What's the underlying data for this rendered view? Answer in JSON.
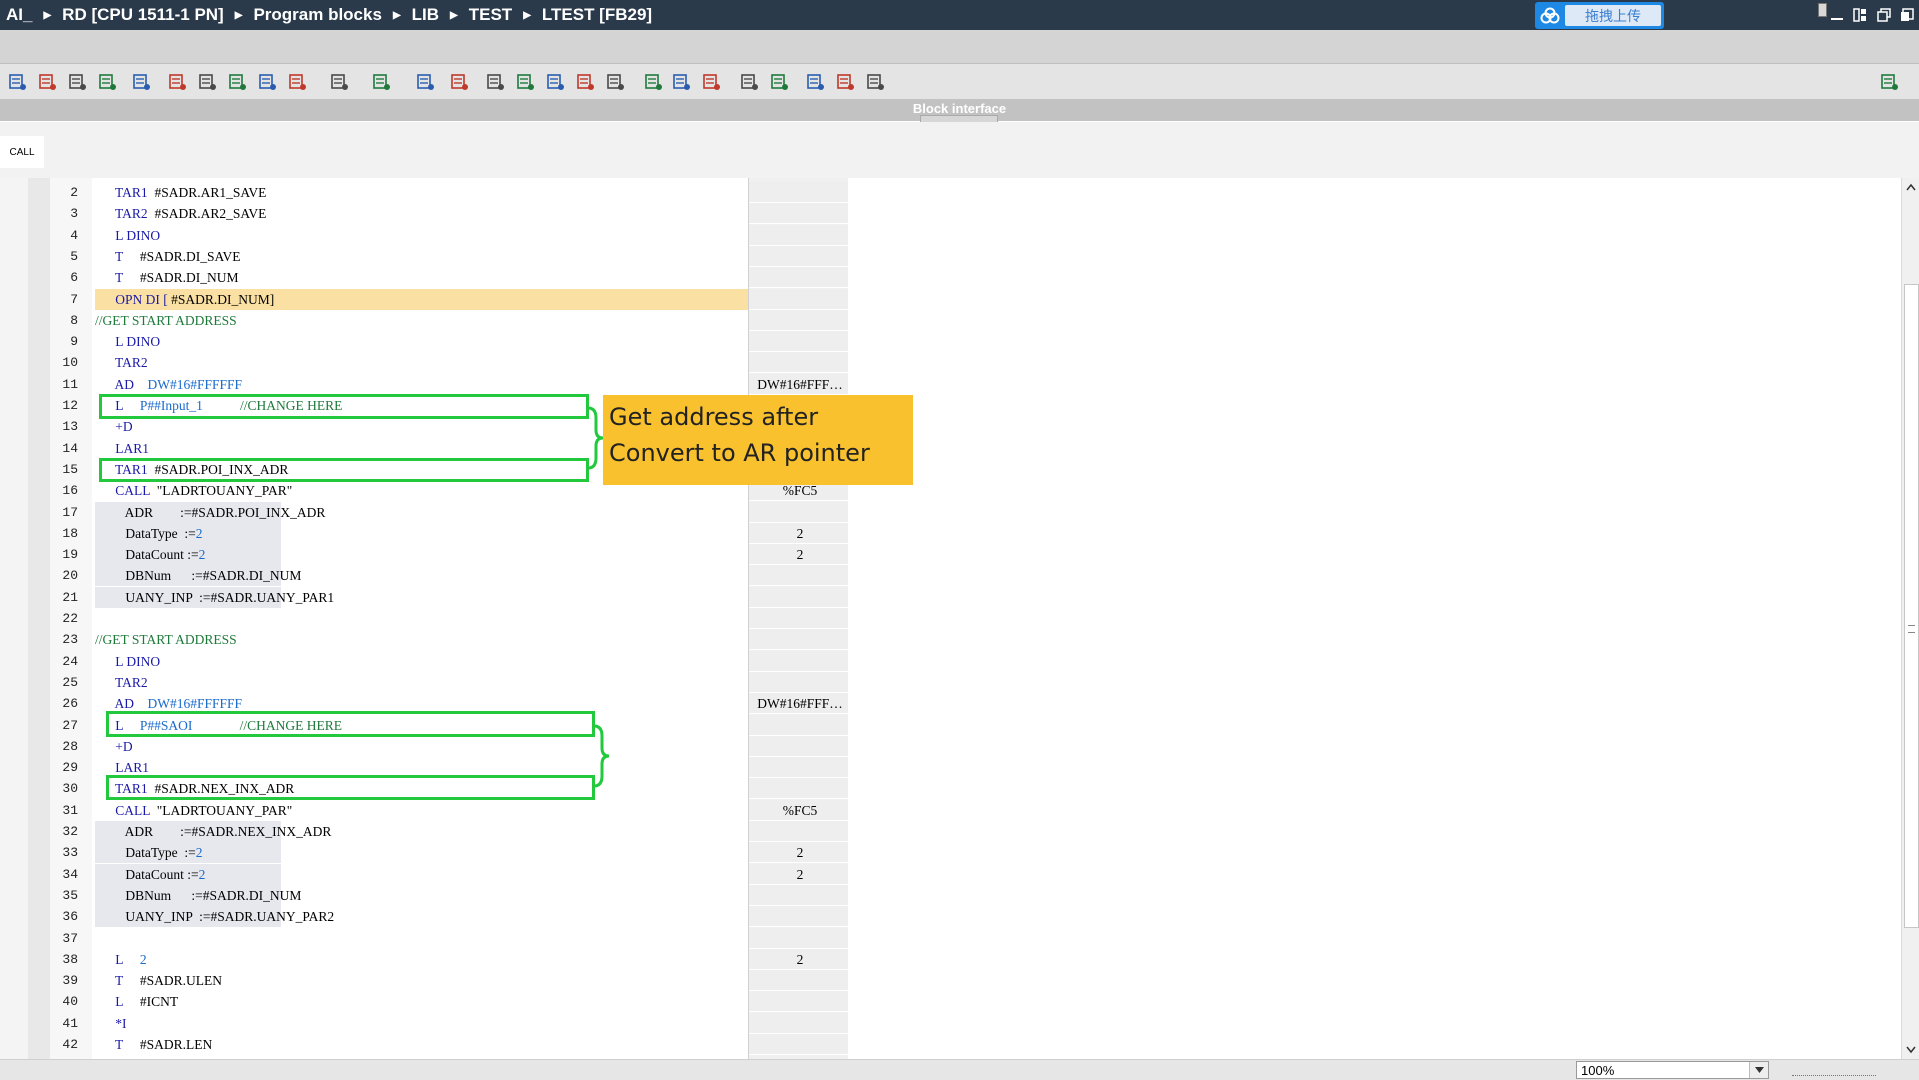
{
  "window": {
    "breadcrumb": [
      "AI_",
      "RD [CPU 1511-1 PN]",
      "Program blocks",
      "LIB",
      "TEST",
      "LTEST [FB29]"
    ],
    "upload_button": "拖拽上传",
    "controls": [
      "minimize-icon",
      "tile-icon",
      "restore-icon",
      "close-icon"
    ]
  },
  "toolbar": {
    "icons": [
      "insert-network-icon",
      "delete-network-icon",
      "insert-row-icon",
      "add-row-icon",
      "absolute-symbolic-icon",
      "indent-icon",
      "show-networks-icon",
      "list-view-icon",
      "comment-icon",
      "open-all-icon",
      "close-all-icon",
      "expand-icon",
      "list-box-icon",
      "favorites-icon",
      "go-to-error-icon",
      "delete-error-icon",
      "monitor-off-icon",
      "monitor-on-icon",
      "download-icon",
      "previous-icon",
      "indent-left-icon",
      "indent-right-icon",
      "undo-icon",
      "redo-icon",
      "find-icon",
      "replace-icon",
      "settings-icon",
      "panel-toggle-icon"
    ]
  },
  "block_interface": {
    "title": "Block interface"
  },
  "tabs": {
    "call": "CALL"
  },
  "code_lines": [
    {
      "n": "2",
      "parts": [
        [
          "kw",
          "      TAR1"
        ],
        [
          "op",
          "  #SADR.AR1_SAVE"
        ]
      ],
      "status": ""
    },
    {
      "n": "3",
      "parts": [
        [
          "kw",
          "      TAR2"
        ],
        [
          "op",
          "  #SADR.AR2_SAVE"
        ]
      ],
      "status": ""
    },
    {
      "n": "4",
      "parts": [
        [
          "kw",
          "      L DINO"
        ]
      ],
      "status": ""
    },
    {
      "n": "5",
      "parts": [
        [
          "kw",
          "      T"
        ],
        [
          "op",
          "     #SADR.DI_SAVE"
        ]
      ],
      "status": ""
    },
    {
      "n": "6",
      "parts": [
        [
          "kw",
          "      T"
        ],
        [
          "op",
          "     #SADR.DI_NUM"
        ]
      ],
      "status": ""
    },
    {
      "n": "7",
      "parts": [
        [
          "kw",
          "      OPN DI ["
        ],
        [
          "op",
          " #SADR.DI_NUM]"
        ]
      ],
      "status": "",
      "highlight": true
    },
    {
      "n": "8",
      "parts": [
        [
          "cm",
          "//GET START ADDRESS"
        ]
      ],
      "status": ""
    },
    {
      "n": "9",
      "parts": [
        [
          "kw",
          "      L DINO"
        ]
      ],
      "status": ""
    },
    {
      "n": "10",
      "parts": [
        [
          "kw",
          "      TAR2"
        ]
      ],
      "status": ""
    },
    {
      "n": "11",
      "parts": [
        [
          "kw",
          "      AD"
        ],
        [
          "num",
          "    DW#16#FFFFFF"
        ]
      ],
      "status": "DW#16#FFF…"
    },
    {
      "n": "12",
      "parts": [
        [
          "kw",
          "      L"
        ],
        [
          "num",
          "     P##Input_1"
        ],
        [
          "cm",
          "           //CHANGE HERE"
        ]
      ],
      "status": ""
    },
    {
      "n": "13",
      "parts": [
        [
          "kw",
          "      +D"
        ]
      ],
      "status": ""
    },
    {
      "n": "14",
      "parts": [
        [
          "kw",
          "      LAR1"
        ]
      ],
      "status": ""
    },
    {
      "n": "15",
      "parts": [
        [
          "kw",
          "      TAR1"
        ],
        [
          "op",
          "  #SADR.POI_INX_ADR"
        ]
      ],
      "status": ""
    },
    {
      "n": "16",
      "parts": [
        [
          "kw",
          "      CALL"
        ],
        [
          "op",
          "  \"LADRTOUANY_PAR\""
        ]
      ],
      "status": "%FC5"
    },
    {
      "n": "17",
      "parts": [
        [
          "op",
          "         ADR        :=#SADR.POI_INX_ADR"
        ]
      ],
      "status": "",
      "param": true
    },
    {
      "n": "18",
      "parts": [
        [
          "op",
          "         DataType  :="
        ],
        [
          "num",
          "2"
        ]
      ],
      "status": "2",
      "param": true
    },
    {
      "n": "19",
      "parts": [
        [
          "op",
          "         DataCount :="
        ],
        [
          "num",
          "2"
        ]
      ],
      "status": "2",
      "param": true
    },
    {
      "n": "20",
      "parts": [
        [
          "op",
          "         DBNum      :=#SADR.DI_NUM"
        ]
      ],
      "status": "",
      "param": true
    },
    {
      "n": "21",
      "parts": [
        [
          "op",
          "         UANY_INP  :=#SADR.UANY_PAR1"
        ]
      ],
      "status": "",
      "param": true
    },
    {
      "n": "22",
      "parts": [
        [
          "op",
          ""
        ]
      ],
      "status": ""
    },
    {
      "n": "23",
      "parts": [
        [
          "cm",
          "//GET START ADDRESS"
        ]
      ],
      "status": ""
    },
    {
      "n": "24",
      "parts": [
        [
          "kw",
          "      L DINO"
        ]
      ],
      "status": ""
    },
    {
      "n": "25",
      "parts": [
        [
          "kw",
          "      TAR2"
        ]
      ],
      "status": ""
    },
    {
      "n": "26",
      "parts": [
        [
          "kw",
          "      AD"
        ],
        [
          "num",
          "    DW#16#FFFFFF"
        ]
      ],
      "status": "DW#16#FFF…"
    },
    {
      "n": "27",
      "parts": [
        [
          "kw",
          "      L"
        ],
        [
          "num",
          "     P##SAOI"
        ],
        [
          "cm",
          "              //CHANGE HERE"
        ]
      ],
      "status": ""
    },
    {
      "n": "28",
      "parts": [
        [
          "kw",
          "      +D"
        ]
      ],
      "status": ""
    },
    {
      "n": "29",
      "parts": [
        [
          "kw",
          "      LAR1"
        ]
      ],
      "status": ""
    },
    {
      "n": "30",
      "parts": [
        [
          "kw",
          "      TAR1"
        ],
        [
          "op",
          "  #SADR.NEX_INX_ADR"
        ]
      ],
      "status": ""
    },
    {
      "n": "31",
      "parts": [
        [
          "kw",
          "      CALL"
        ],
        [
          "op",
          "  \"LADRTOUANY_PAR\""
        ]
      ],
      "status": "%FC5"
    },
    {
      "n": "32",
      "parts": [
        [
          "op",
          "         ADR        :=#SADR.NEX_INX_ADR"
        ]
      ],
      "status": "",
      "param": true
    },
    {
      "n": "33",
      "parts": [
        [
          "op",
          "         DataType  :="
        ],
        [
          "num",
          "2"
        ]
      ],
      "status": "2",
      "param": true
    },
    {
      "n": "34",
      "parts": [
        [
          "op",
          "         DataCount :="
        ],
        [
          "num",
          "2"
        ]
      ],
      "status": "2",
      "param": true
    },
    {
      "n": "35",
      "parts": [
        [
          "op",
          "         DBNum      :=#SADR.DI_NUM"
        ]
      ],
      "status": "",
      "param": true
    },
    {
      "n": "36",
      "parts": [
        [
          "op",
          "         UANY_INP  :=#SADR.UANY_PAR2"
        ]
      ],
      "status": "",
      "param": true
    },
    {
      "n": "37",
      "parts": [
        [
          "op",
          ""
        ]
      ],
      "status": ""
    },
    {
      "n": "38",
      "parts": [
        [
          "kw",
          "      L"
        ],
        [
          "num",
          "     2"
        ]
      ],
      "status": "2"
    },
    {
      "n": "39",
      "parts": [
        [
          "kw",
          "      T"
        ],
        [
          "op",
          "     #SADR.ULEN"
        ]
      ],
      "status": ""
    },
    {
      "n": "40",
      "parts": [
        [
          "kw",
          "      L"
        ],
        [
          "op",
          "     #ICNT"
        ]
      ],
      "status": ""
    },
    {
      "n": "41",
      "parts": [
        [
          "kw",
          "      *I"
        ]
      ],
      "status": ""
    },
    {
      "n": "42",
      "parts": [
        [
          "kw",
          "      T"
        ],
        [
          "op",
          "     #SADR.LEN"
        ]
      ],
      "status": ""
    }
  ],
  "callout": {
    "line1": "Get address after",
    "line2": "Convert to AR pointer"
  },
  "colors": {
    "title_bar": "#2b3a4a",
    "highlight_row": "#fbe0a3",
    "annotation_box": "#22c93c",
    "callout_bg": "#f9c12e"
  },
  "statusbar": {
    "zoom": "100%"
  }
}
